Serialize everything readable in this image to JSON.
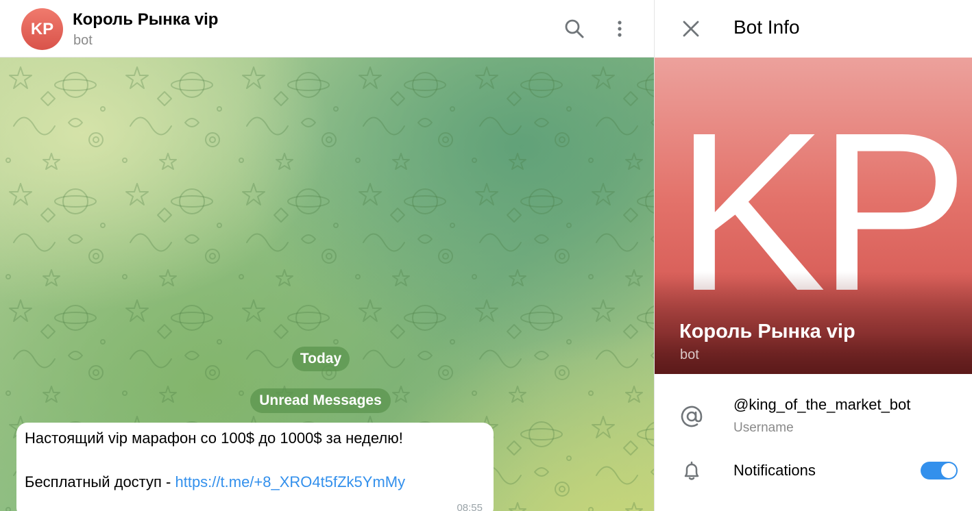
{
  "chat": {
    "avatar_initials": "KP",
    "title": "Король Рынка vip",
    "subtitle": "bot",
    "icons": {
      "search": "search-icon",
      "more": "more-vertical-icon"
    },
    "date_divider": "Today",
    "unread_divider": "Unread Messages",
    "message": {
      "line1": "Настоящий vip марафон со 100$ до 1000$ за неделю!",
      "line2_prefix": "Бесплатный доступ - ",
      "link": "https://t.me/+8_XRO4t5fZk5YmMy",
      "time": "08:55"
    }
  },
  "panel": {
    "title": "Bot Info",
    "close_icon": "close-icon",
    "profile": {
      "initials": "KP",
      "name": "Король Рынка vip",
      "subtitle": "bot"
    },
    "username": {
      "icon": "at-sign-icon",
      "value": "@king_of_the_market_bot",
      "label": "Username"
    },
    "notifications": {
      "icon": "bell-icon",
      "label": "Notifications",
      "enabled": true
    }
  },
  "colors": {
    "accent": "#3390ec",
    "avatar": "#e0574e",
    "chat_pill": "#5c9650"
  }
}
